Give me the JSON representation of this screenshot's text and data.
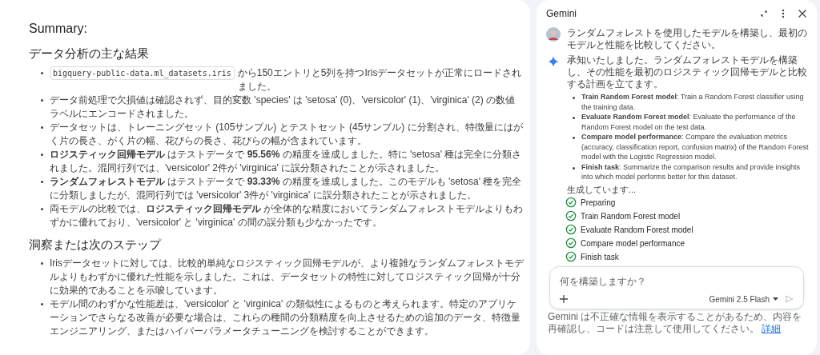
{
  "summary": {
    "title": "Summary:",
    "sections": [
      {
        "heading": "データ分析の主な結果",
        "items": [
          {
            "code": "bigquery-public-data.ml_datasets.iris",
            "text": "から150エントリと5列を持つIrisデータセットが正常にロードされました。"
          },
          {
            "text": "データ前処理で欠損値は確認されず、目的変数 'species' は 'setosa' (0)、'versicolor' (1)、'virginica' (2) の数値ラベルにエンコードされました。"
          },
          {
            "text": "データセットは、トレーニングセット (105サンプル) とテストセット (45サンプル) に分割され、特徴量にはがく片の長さ、がく片の幅、花びらの長さ、花びらの幅が含まれています。"
          },
          {
            "text": "**ロジスティック回帰モデル** はテストデータで **95.56%** の精度を達成しました。特に 'setosa' 種は完全に分類されました。混同行列では、'versicolor' 2件が 'virginica' に誤分類されたことが示されました。"
          },
          {
            "text": "**ランダムフォレストモデル** はテストデータで **93.33%** の精度を達成しました。このモデルも 'setosa' 種を完全に分類しましたが、混同行列では 'versicolor' 3件が 'virginica' に誤分類されたことが示されました。"
          },
          {
            "text": "両モデルの比較では、**ロジスティック回帰モデル** が全体的な精度においてランダムフォレストモデルよりもわずかに優れており、'versicolor' と 'virginica' の間の誤分類も少なかったです。"
          }
        ]
      },
      {
        "heading": "洞察または次のステップ",
        "items": [
          {
            "text": "Irisデータセットに対しては、比較的単純なロジスティック回帰モデルが、より複雑なランダムフォレストモデルよりもわずかに優れた性能を示しました。これは、データセットの特性に対してロジスティック回帰が十分に効果的であることを示唆しています。"
          },
          {
            "text": "モデル間のわずかな性能差は、'versicolor' と 'virginica' の類似性によるものと考えられます。特定のアプリケーションでさらなる改善が必要な場合は、これらの種間の分類精度を向上させるための追加のデータ、特徴量エンジニアリング、またはハイパーパラメータチューニングを検討することができます。"
          }
        ]
      }
    ]
  },
  "gemini": {
    "title": "Gemini",
    "user_message": "ランダムフォレストを使用したモデルを構築し、最初のモデルと性能を比較してください。",
    "reply": "承知いたしました。ランダムフォレストモデルを構築し、その性能を最初のロジスティック回帰モデルと比較する計画を立てます。",
    "plan": [
      "**Train Random Forest model**: Train a Random Forest classifier using the training data.",
      "**Evaluate Random Forest model**: Evaluate the performance of the Random Forest model on the test data.",
      "**Compare model performance**: Compare the evaluation metrics (accuracy, classification report, confusion matrix) of the Random Forest model with the Logistic Regression model.",
      "**Finish task**: Summarize the comparison results and provide insights into which model performs better for this dataset."
    ],
    "status": "生成しています...",
    "steps": [
      {
        "label": "Preparing",
        "done": true
      },
      {
        "label": "Train Random Forest model",
        "done": true
      },
      {
        "label": "Evaluate Random Forest model",
        "done": true
      },
      {
        "label": "Compare model performance",
        "done": true
      },
      {
        "label": "Finish task",
        "done": true
      }
    ],
    "input": {
      "placeholder": "何を構築しますか？"
    },
    "model": "Gemini 2.5 Flash",
    "disclaimer": "Gemini は不正確な情報を表示することがあるため、内容を再確認し、コードは注意して使用してください。",
    "link": "詳細"
  }
}
